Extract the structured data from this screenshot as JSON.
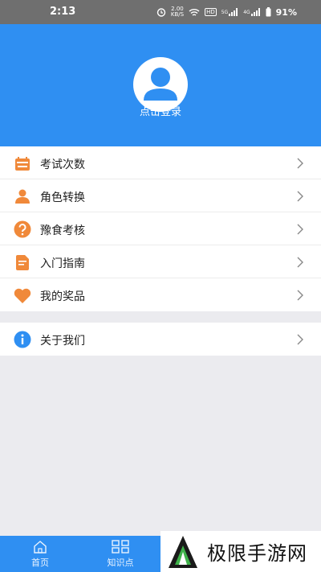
{
  "status_bar": {
    "time": "2:13",
    "net_speed_value": "2.00",
    "net_speed_unit": "KB/S",
    "hd_label": "HD",
    "signal1_label": "5G",
    "signal2_label": "4G",
    "battery": "91%"
  },
  "header": {
    "login_text": "点击登录",
    "bg_color": "#2f8ff2"
  },
  "menu": {
    "items": [
      {
        "label": "考试次数",
        "icon": "calendar-icon",
        "color": "#f0893a"
      },
      {
        "label": "角色转换",
        "icon": "person-icon",
        "color": "#f0893a"
      },
      {
        "label": "豫食考核",
        "icon": "question-icon",
        "color": "#f0893a"
      },
      {
        "label": "入门指南",
        "icon": "document-icon",
        "color": "#f0893a"
      },
      {
        "label": "我的奖品",
        "icon": "heart-icon",
        "color": "#f0893a"
      }
    ]
  },
  "menu2": {
    "items": [
      {
        "label": "关于我们",
        "icon": "info-icon",
        "color": "#2f8ff2"
      }
    ]
  },
  "tabbar": {
    "tabs": [
      {
        "label": "首页",
        "icon": "home-icon"
      },
      {
        "label": "知识点",
        "icon": "grid-icon"
      }
    ]
  },
  "watermark": {
    "text": "极限手游网"
  }
}
